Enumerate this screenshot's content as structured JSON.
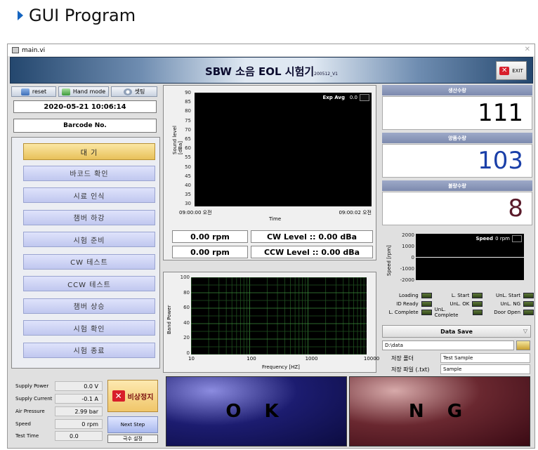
{
  "heading": "GUI Program",
  "window": {
    "title": "main.vi"
  },
  "banner": {
    "title": "SBW 소음 EOL 시험기",
    "version": "200512_V1",
    "exit_label": "EXIT"
  },
  "toolbar": {
    "reset_label": "reset",
    "hand_label": "Hand mode",
    "setting_label": "셋팅"
  },
  "datetime": "2020-05-21  10:06:14",
  "barcode_label": "Barcode No.",
  "steps": [
    "대 기",
    "바코드 확인",
    "시료 인식",
    "챔버 하강",
    "시험 준비",
    "CW 테스트",
    "CCW  테스트",
    "챔버 상승",
    "시험 확인",
    "시험 종료"
  ],
  "sound_chart": {
    "ylabel": "Sound level [dBa]",
    "xlabel": "Time",
    "y_ticks": [
      "90",
      "85",
      "80",
      "75",
      "70",
      "65",
      "60",
      "55",
      "50",
      "45",
      "40",
      "35",
      "30"
    ],
    "x_start": "09:00:00 오전",
    "x_end": "09:00:02 오전",
    "legend_label": "Exp Avg",
    "legend_value": "0.0"
  },
  "readouts": {
    "cw_rpm": "0.00 rpm",
    "cw_level": "CW Level ::  0.00 dBa",
    "ccw_rpm": "0.00 rpm",
    "ccw_level": "CCW Level ::  0.00 dBa"
  },
  "band_chart": {
    "ylabel": "Band Power",
    "xlabel": "Frequency [HZ]",
    "y_ticks": [
      "100",
      "80",
      "60",
      "40",
      "20",
      "0"
    ],
    "x_ticks": [
      "10",
      "100",
      "1000",
      "10000"
    ]
  },
  "counters": {
    "production_label": "생산수량",
    "production_value": "111",
    "good_label": "양품수량",
    "good_value": "103",
    "bad_label": "불량수량",
    "bad_value": "8"
  },
  "speed_chart": {
    "ylabel": "Speed [rpm]",
    "y_ticks": [
      "2000",
      "1000",
      "0",
      "-1000",
      "-2000"
    ],
    "legend_label": "Speed",
    "legend_value": "0 rpm"
  },
  "leds": {
    "col1": [
      "Loading",
      "ID Ready",
      "L. Complete"
    ],
    "col2": [
      "L. Start",
      "UnL. OK",
      "UnL. Complete"
    ],
    "col3": [
      "UnL. Start",
      "UnL. NG",
      "Door Open"
    ]
  },
  "data_save": {
    "label": "Data Save",
    "path": "D:\\data",
    "folder_label": "저장 폴더",
    "folder_value": "Test Sample",
    "file_label": "저장 파일 (.txt)",
    "file_value": "Sample"
  },
  "status": {
    "supply_power_label": "Supply Power",
    "supply_power": "0.0 V",
    "supply_current_label": "Supply Current",
    "supply_current": "-0.1 A",
    "air_pressure_label": "Air Pressure",
    "air_pressure": "2.99 bar",
    "speed_label": "Speed",
    "speed": "0 rpm",
    "test_time_label": "Test Time",
    "test_time": "0.0"
  },
  "estop_label": "비상정지",
  "next_step_label": "Next Step",
  "polarity_label": "극수 설정",
  "ok_label": "O K",
  "ng_label": "N G",
  "colors": {
    "good": "#1a3fa8",
    "bad": "#5a1a2a",
    "led": "#3f5a24",
    "step_active": "#e8c15a"
  }
}
